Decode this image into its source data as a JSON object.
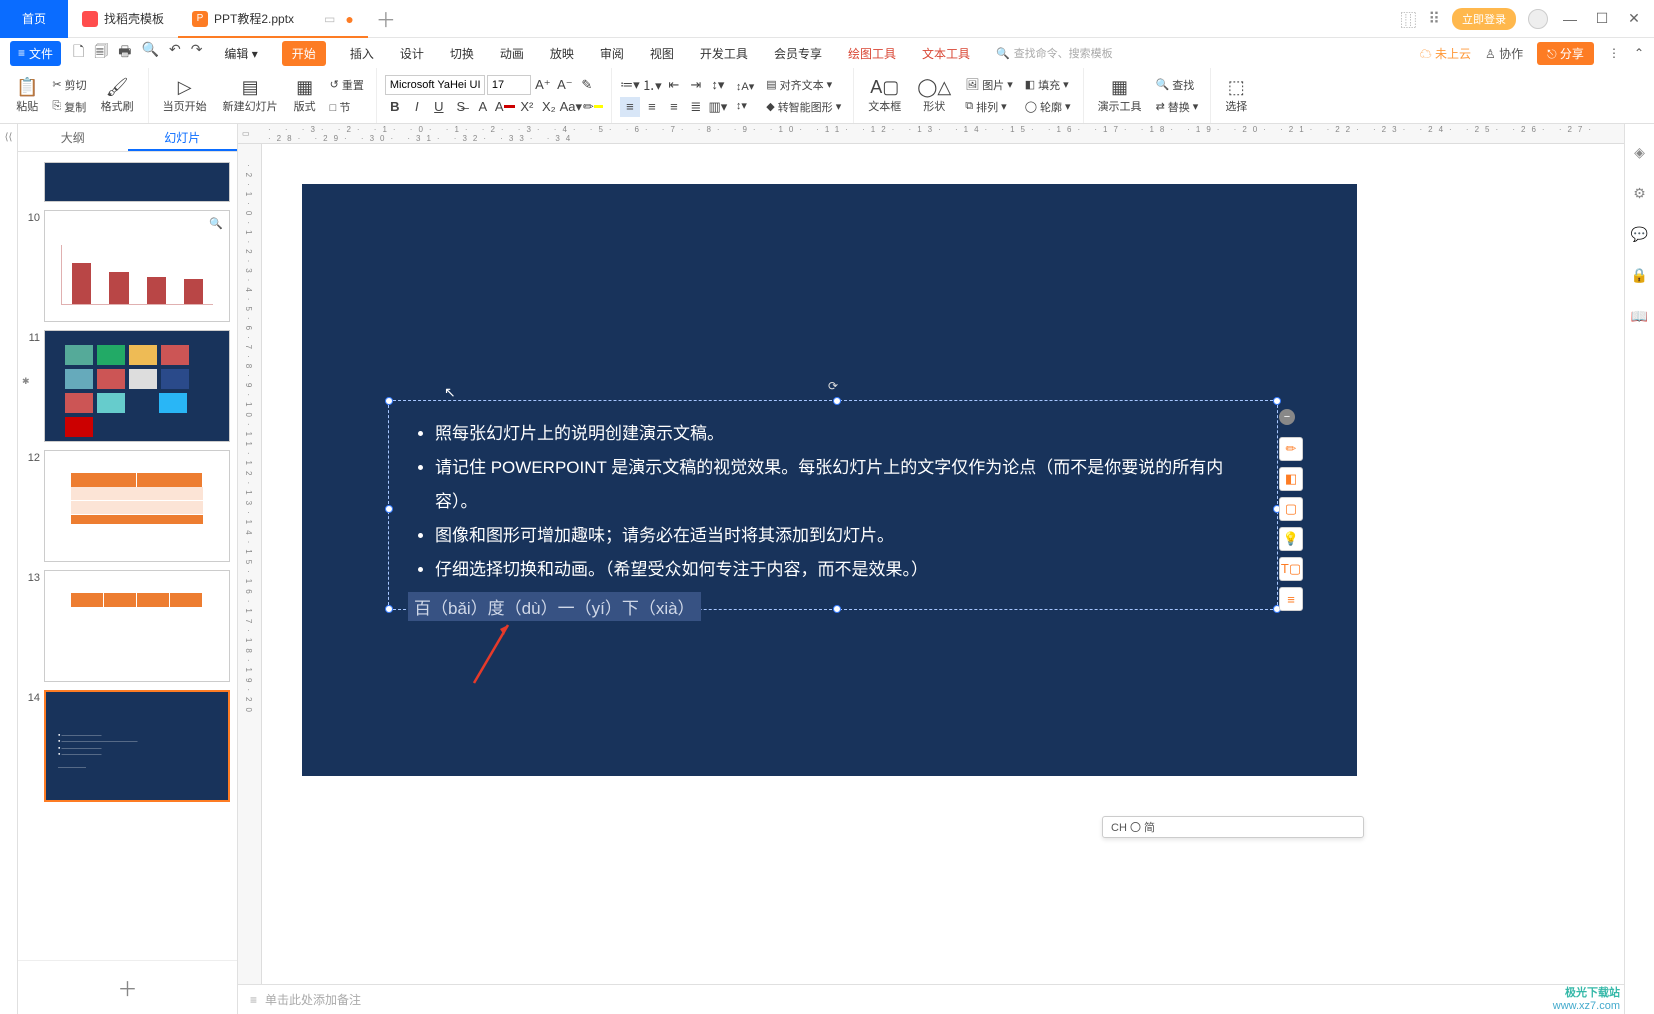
{
  "tabs": {
    "home": "首页",
    "docer": "找稻壳模板",
    "file": "PPT教程2.pptx"
  },
  "titlebar": {
    "login": "立即登录"
  },
  "menubar": {
    "file": "文件",
    "edit": "编辑",
    "start": "开始",
    "insert": "插入",
    "design": "设计",
    "transition": "切换",
    "animation": "动画",
    "slideshow": "放映",
    "review": "审阅",
    "view": "视图",
    "dev": "开发工具",
    "vip": "会员专享",
    "drawtool": "绘图工具",
    "texttool": "文本工具",
    "searchHint": "查找命令、搜索模板",
    "cloud": "未上云",
    "collab": "协作",
    "share": "分享"
  },
  "ribbon": {
    "paste": "粘贴",
    "cut": "剪切",
    "copy": "复制",
    "fmtPainter": "格式刷",
    "fromCurrent": "当页开始",
    "newSlide": "新建幻灯片",
    "layout": "版式",
    "sections": "□ 节",
    "reset": "重置",
    "font": "Microsoft YaHei UI",
    "fontSize": "17",
    "textbox": "文本框",
    "shape": "形状",
    "picture": "图片",
    "arrange": "排列",
    "fill": "填充",
    "outline": "轮廓",
    "alignText": "对齐文本",
    "smartArt": "转智能图形",
    "presTools": "演示工具",
    "find": "查找",
    "replace": "替换",
    "select": "选择"
  },
  "panel": {
    "outline": "大纲",
    "slides": "幻灯片"
  },
  "thumbNums": {
    "a": "10",
    "b": "11",
    "c": "12",
    "d": "13",
    "e": "14"
  },
  "slide": {
    "b1": "照每张幻灯片上的说明创建演示文稿。",
    "b2": "请记住 POWERPOINT 是演示文稿的视觉效果。每张幻灯片上的文字仅作为论点（而不是你要说的所有内容）。",
    "b3": "图像和图形可增加趣味；请务必在适当时将其添加到幻灯片。",
    "b4": "仔细选择切换和动画。（希望受众如何专注于内容，而不是效果。）",
    "pinyin": "百（bǎi）度（dù）一（yí）下（xià）"
  },
  "ime": "CH 〇 简",
  "notesHint": "单击此处添加备注",
  "watermark": {
    "a": "极光下载站",
    "b": "www.xz7.com"
  }
}
